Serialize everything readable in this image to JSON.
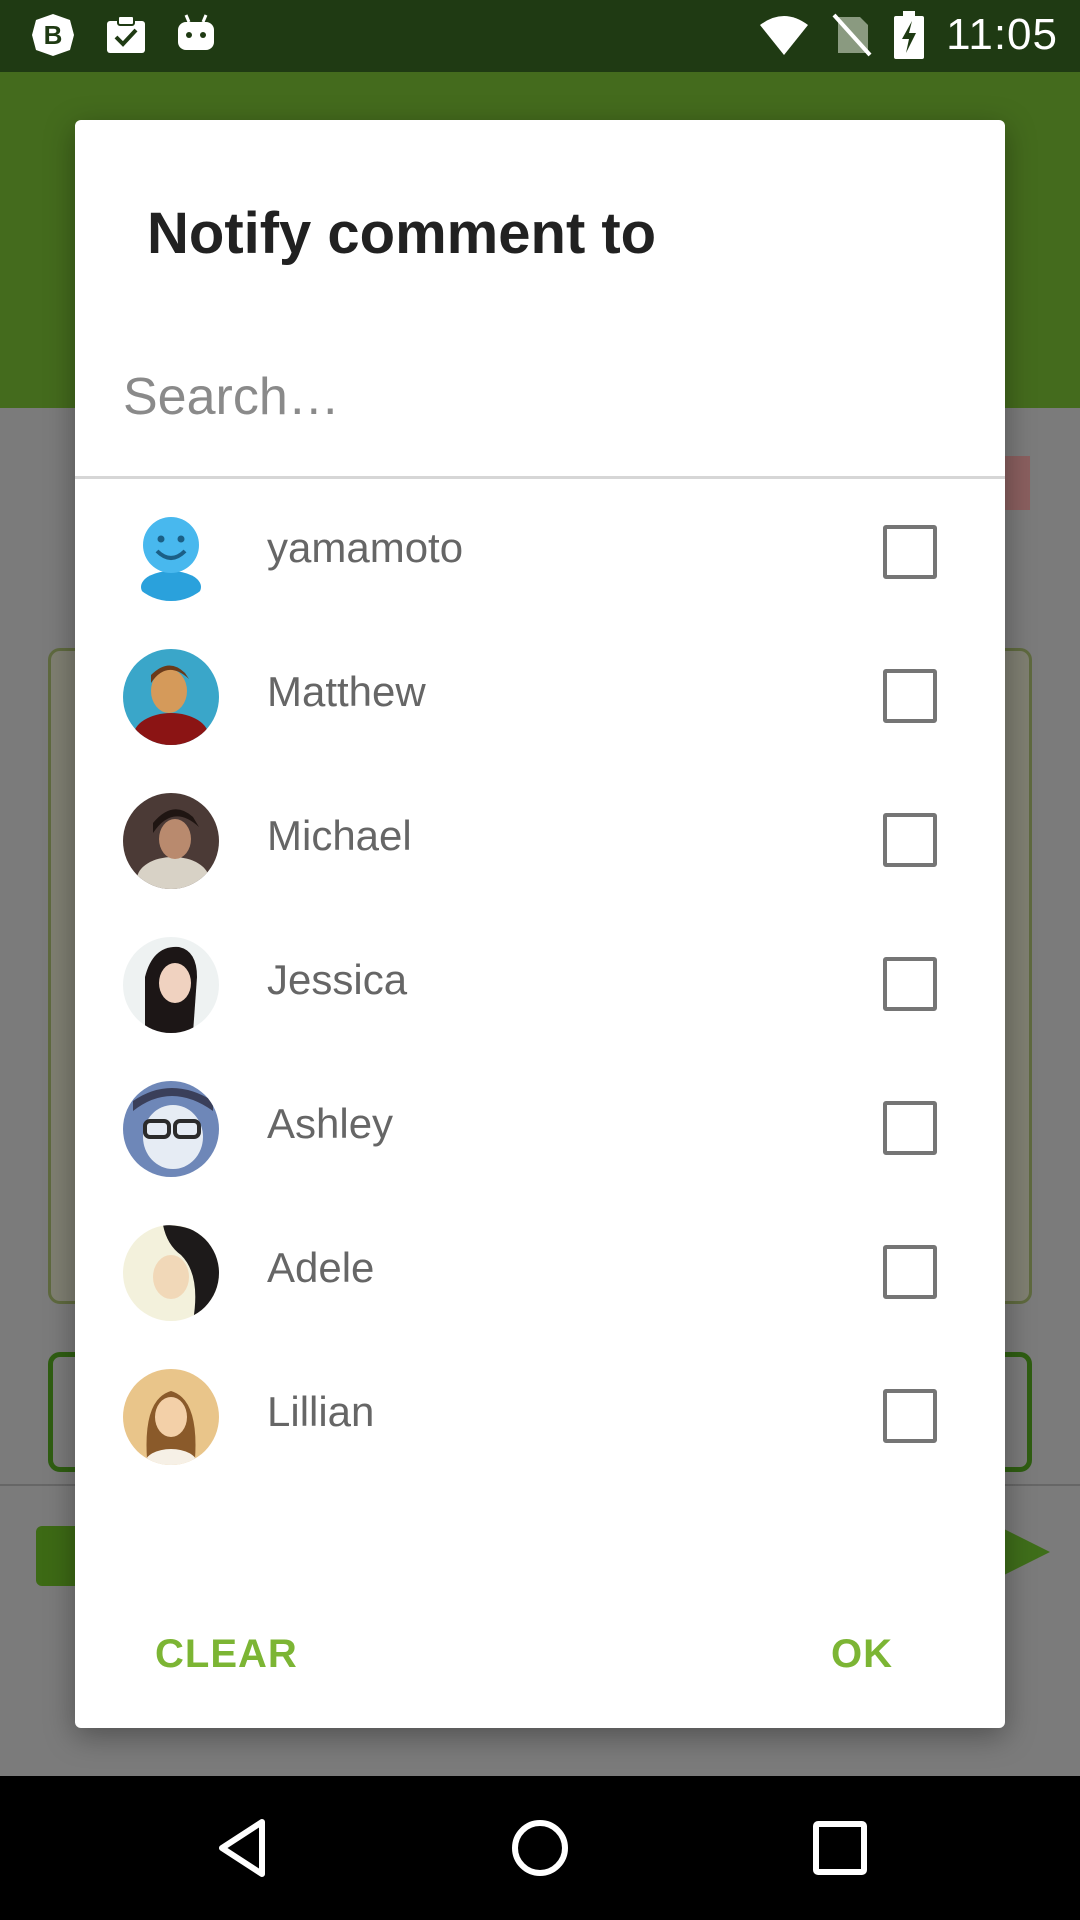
{
  "status_bar": {
    "time": "11:05",
    "icons_left": [
      "beta-app-icon",
      "clipboard-check-icon",
      "android-icon"
    ],
    "icons_right": [
      "wifi-icon",
      "no-sim-icon",
      "battery-charging-icon"
    ]
  },
  "dialog": {
    "title": "Notify comment to",
    "search_placeholder": "Search…",
    "users": [
      {
        "name": "yamamoto",
        "avatar": "smiley-avatar",
        "checked": false
      },
      {
        "name": "Matthew",
        "avatar": "photo-avatar",
        "checked": false
      },
      {
        "name": "Michael",
        "avatar": "photo-avatar",
        "checked": false
      },
      {
        "name": "Jessica",
        "avatar": "photo-avatar",
        "checked": false
      },
      {
        "name": "Ashley",
        "avatar": "photo-avatar",
        "checked": false
      },
      {
        "name": "Adele",
        "avatar": "photo-avatar",
        "checked": false
      },
      {
        "name": "Lillian",
        "avatar": "photo-avatar",
        "checked": false
      }
    ],
    "clear_label": "CLEAR",
    "ok_label": "OK"
  },
  "colors": {
    "accent": "#7cb534",
    "status_bar": "#1f3a13",
    "scrim_header": "#446b1d"
  },
  "nav_bar": {
    "icons": [
      "back-icon",
      "home-icon",
      "recents-icon"
    ]
  }
}
